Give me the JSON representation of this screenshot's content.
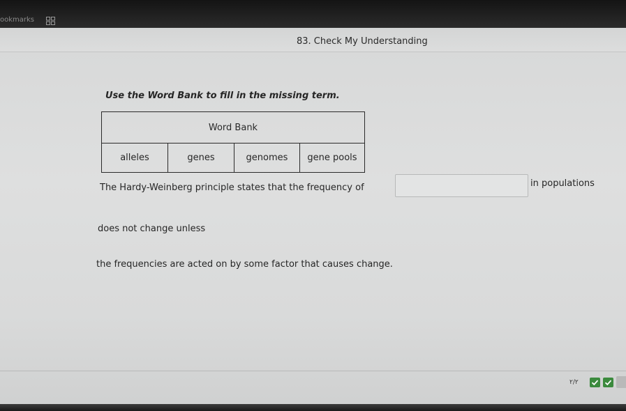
{
  "browser": {
    "bookmarks_label": "ookmarks"
  },
  "header": {
    "title": "83. Check My Understanding"
  },
  "main": {
    "instruction": "Use the Word Bank to fill in the missing term.",
    "word_bank": {
      "title": "Word Bank",
      "words": [
        "alleles",
        "genes",
        "genomes",
        "gene pools"
      ]
    },
    "sentence": {
      "part1": "The Hardy-Weinberg principle states that the frequency of",
      "answer_value": "",
      "part2": "in populations",
      "part3": "does not change unless",
      "part4": "the frequencies are acted on by some factor that causes change."
    }
  },
  "footer": {
    "page_counter": "٢/٢",
    "check_icon": "checkmark-icon",
    "accent_color": "#3b8a3d"
  }
}
